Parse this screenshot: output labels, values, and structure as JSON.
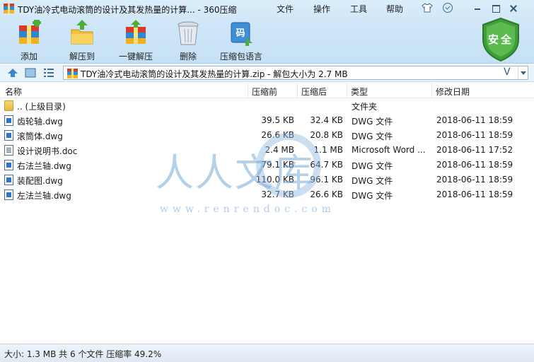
{
  "window": {
    "title": "TDY油冷式电动滚筒的设计及其发热量的计算... - 360压缩"
  },
  "menu": {
    "file": "文件",
    "operation": "操作",
    "tools": "工具",
    "help": "帮助"
  },
  "toolbar": {
    "add": "添加",
    "extract_to": "解压到",
    "one_click_extract": "一键解压",
    "delete": "删除",
    "archive_language": "压缩包语言",
    "security_badge": "安全"
  },
  "address": {
    "path": "TDY油冷式电动滚筒的设计及其发热量的计算.zip - 解包大小为 2.7 MB",
    "v_label": "V"
  },
  "columns": {
    "name": "名称",
    "before": "压缩前",
    "after": "压缩后",
    "type": "类型",
    "date": "修改日期"
  },
  "rows": [
    {
      "name": ".. (上级目录)",
      "before": "",
      "after": "",
      "type": "文件夹",
      "date": "",
      "icon": "folder-icon"
    },
    {
      "name": "齿轮轴.dwg",
      "before": "39.5 KB",
      "after": "32.4 KB",
      "type": "DWG 文件",
      "date": "2018-06-11 18:59",
      "icon": "dwg-file-icon"
    },
    {
      "name": "滚筒体.dwg",
      "before": "26.6 KB",
      "after": "20.8 KB",
      "type": "DWG 文件",
      "date": "2018-06-11 18:59",
      "icon": "dwg-file-icon"
    },
    {
      "name": "设计说明书.doc",
      "before": "2.4 MB",
      "after": "1.1 MB",
      "type": "Microsoft Word ...",
      "date": "2018-06-11 17:52",
      "icon": "word-file-icon"
    },
    {
      "name": "右法兰轴.dwg",
      "before": "79.1 KB",
      "after": "64.7 KB",
      "type": "DWG 文件",
      "date": "2018-06-11 18:59",
      "icon": "dwg-file-icon"
    },
    {
      "name": "装配图.dwg",
      "before": "110.0 KB",
      "after": "96.1 KB",
      "type": "DWG 文件",
      "date": "2018-06-11 18:59",
      "icon": "dwg-file-icon"
    },
    {
      "name": "左法兰轴.dwg",
      "before": "32.7 KB",
      "after": "26.6 KB",
      "type": "DWG 文件",
      "date": "2018-06-11 18:59",
      "icon": "dwg-file-icon"
    }
  ],
  "watermark": {
    "text": "人人文库",
    "url": "www.renrendoc.com"
  },
  "status": {
    "text": "大小: 1.3 MB 共 6 个文件 压缩率 49.2%"
  }
}
